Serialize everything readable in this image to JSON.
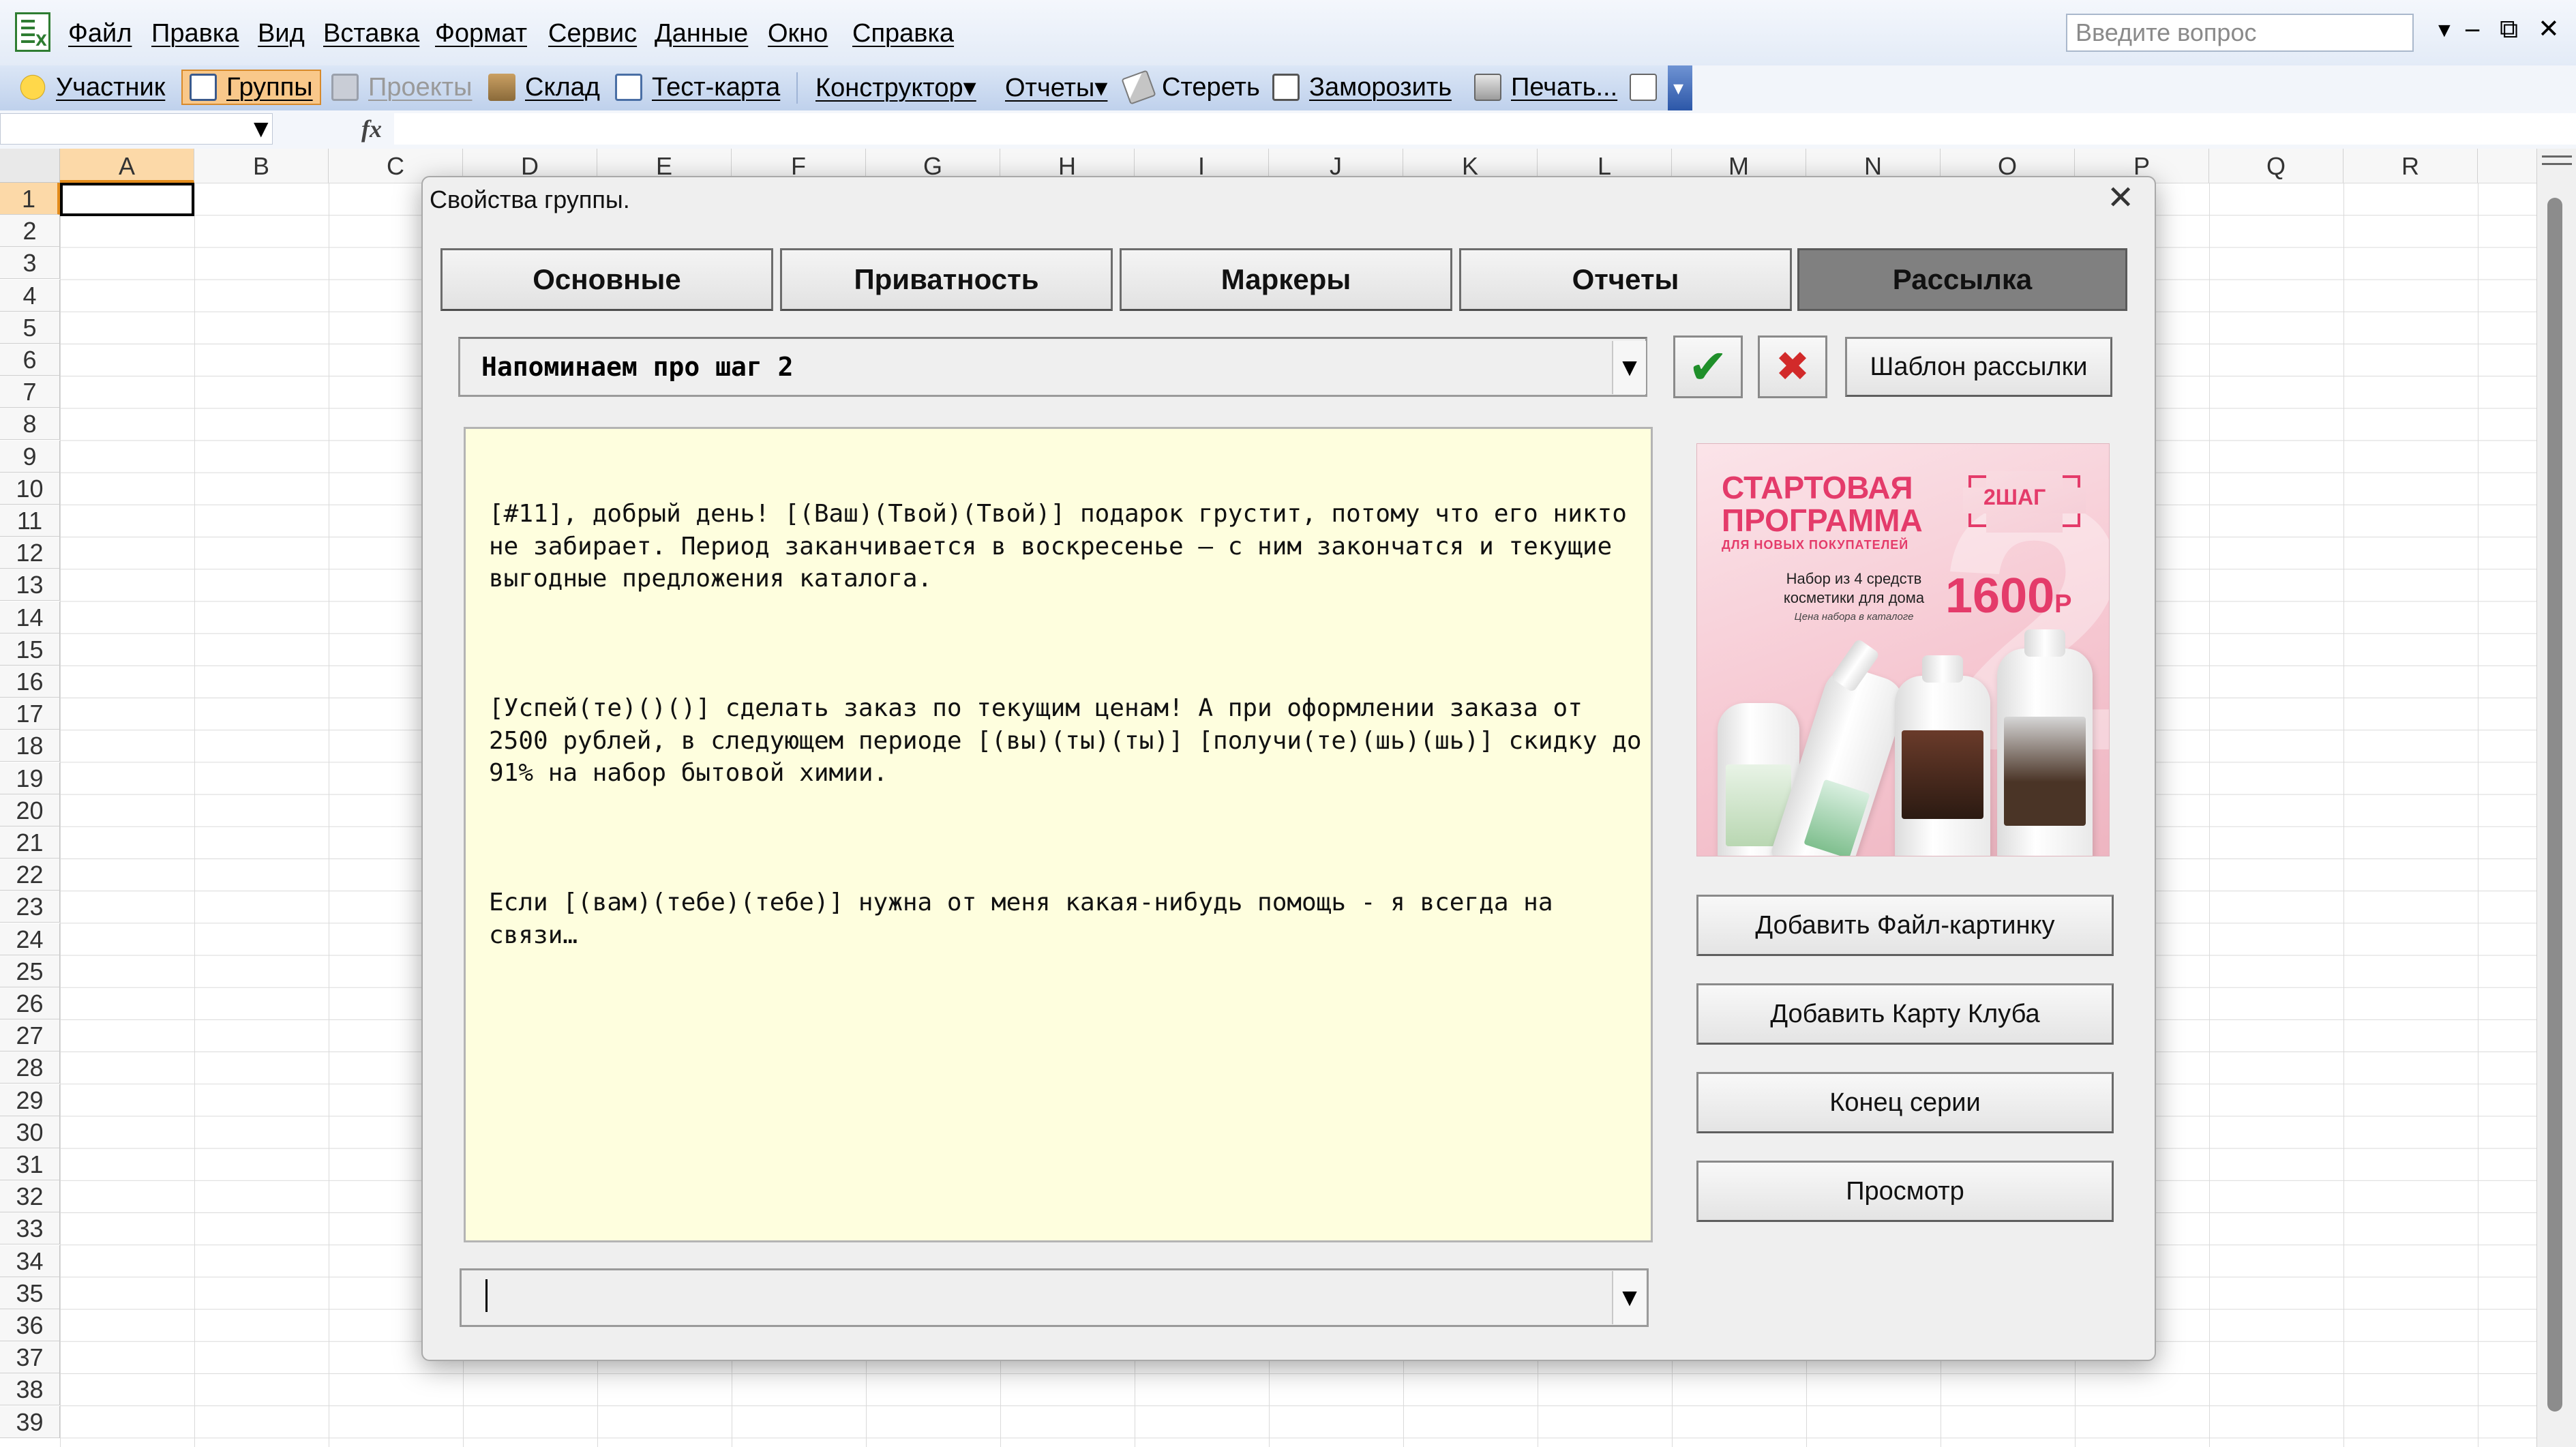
{
  "menubar": {
    "items": [
      "Файл",
      "Правка",
      "Вид",
      "Вставка",
      "Формат",
      "Сервис",
      "Данные",
      "Окно",
      "Справка"
    ],
    "ask_placeholder": "Введите вопрос",
    "window_controls": [
      "‒",
      "⧉",
      "✕"
    ]
  },
  "toolbar": {
    "items": [
      {
        "label": "Участник",
        "icon": "smiley-icon"
      },
      {
        "label": "Группы",
        "icon": "groups-icon",
        "state": "active"
      },
      {
        "label": "Проекты",
        "icon": "projects-icon",
        "state": "disabled"
      },
      {
        "label": "Склад",
        "icon": "warehouse-icon"
      },
      {
        "label": "Тест-карта",
        "icon": "test-card-icon"
      },
      {
        "label": "Конструктор▾",
        "icon": null
      },
      {
        "label": "Отчеты▾",
        "icon": null
      },
      {
        "label": "Стереть",
        "icon": "eraser-icon"
      },
      {
        "label": "Заморозить",
        "icon": "freeze-icon"
      },
      {
        "label": "Печать...",
        "icon": "print-icon"
      }
    ]
  },
  "formula_bar": {
    "fx": "fx"
  },
  "sheet": {
    "columns": [
      "A",
      "B",
      "C",
      "D",
      "E",
      "F",
      "G",
      "H",
      "I",
      "J",
      "K",
      "L",
      "M",
      "N",
      "O",
      "P",
      "Q",
      "R"
    ],
    "rows": [
      "1",
      "2",
      "3",
      "4",
      "5",
      "6",
      "7",
      "8",
      "9",
      "10",
      "11",
      "12",
      "13",
      "14",
      "15",
      "16",
      "17",
      "18",
      "19",
      "20",
      "21",
      "22",
      "23",
      "24",
      "25",
      "26",
      "27",
      "28",
      "29",
      "30",
      "31",
      "32",
      "33",
      "34",
      "35",
      "36",
      "37",
      "38",
      "39"
    ],
    "active_cell": "A1"
  },
  "dialog": {
    "title": "Свойства группы.",
    "close": "✕",
    "tabs": [
      "Основные",
      "Приватность",
      "Маркеры",
      "Отчеты",
      "Рассылка"
    ],
    "selected_tab": "Рассылка",
    "template_select": "Напоминаем про шаг 2",
    "ok_glyph": "✔",
    "cancel_glyph": "✖",
    "template_button": "Шаблон рассылки",
    "message": [
      "[#11], добрый день! [(Ваш)(Твой)(Твой)] подарок грустит, потому что его никто не забирает. Период заканчивается в воскресенье — с ним закончатся и текущие выгодные предложения каталога.",
      "[Успей(те)()()] сделать заказ по текущим ценам! А при оформлении заказа от 2500 рублей, в следующем периоде [(вы)(ты)(ты)] [получи(те)(шь)(шь)] скидку до 91% на набор бытовой химии.",
      "Если [(вам)(тебе)(тебе)] нужна от меня какая-нибудь помощь - я всегда на связи…"
    ],
    "side_buttons": [
      "Добавить Файл-картинку",
      "Добавить Карту Клуба",
      "Конец серии",
      "Просмотр"
    ],
    "bottom_select": "",
    "promo": {
      "title": "СТАРТОВАЯ ПРОГРАММА",
      "subtitle": "ДЛЯ НОВЫХ ПОКУПАТЕЛЕЙ",
      "step": "2ШАГ",
      "description": "Набор из 4 средств косметики для дома",
      "note": "Цена набора в каталоге",
      "price": "1600",
      "currency": "Р",
      "colors": {
        "accent": "#e43b6a",
        "background": "#f6c8d2"
      }
    }
  }
}
